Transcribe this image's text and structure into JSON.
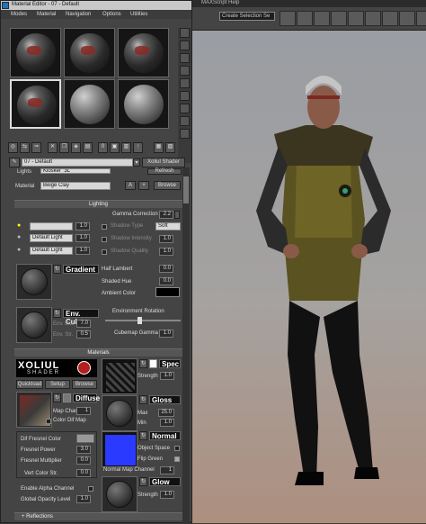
{
  "max": {
    "menu": [
      "MAXScript",
      "Help"
    ],
    "selection_set": "Create Selection Se"
  },
  "editor": {
    "title": "Material Editor - 07 - Default",
    "menu": [
      "Modes",
      "Material",
      "Navigation",
      "Options",
      "Utilities"
    ],
    "material_name": "07 - Default",
    "shader_button": "Xoliul Shader",
    "lights_label": "Lights",
    "lights_value": "Kiosker_3L",
    "refresh": "Refresh",
    "material_label": "Material",
    "material_value": "Beige Clay",
    "btn_a": "A",
    "btn_plus": "+",
    "browse": "Browse",
    "lighting": {
      "header": "Lighting",
      "gamma_label": "Gamma Correction",
      "gamma": "2.2",
      "light1_value": "1.0",
      "light2_value": "1.0",
      "light3_value": "1.0",
      "light_dd2": "Default Light",
      "light_dd3": "Default Light",
      "shadow_type_label": "Shadow Type",
      "shadow_type": "Soft",
      "shadow_intensity_label": "Shadow Intensity",
      "shadow_intensity": "1.0",
      "shadow_quality_label": "Shadow Quality",
      "shadow_quality": "1.0",
      "gradient": "Gradient",
      "half_lambert_label": "Half Lambert",
      "half_lambert": "0.0",
      "shaded_hue_label": "Shaded Hue",
      "shaded_hue": "0.0",
      "ambient_label": "Ambient Color",
      "env_cube": "Env. Cube",
      "env_blur_label": "Env. Blur",
      "env_blur": "7.0",
      "env_str_label": "Env. Str.",
      "env_str": "0.5",
      "env_rotation_label": "Environment Rotation",
      "cubemap_gamma_label": "Cubemap Gamma",
      "cubemap_gamma": "1.0"
    },
    "materials": {
      "header": "Materials",
      "logo_main": "XOLIUL",
      "logo_sub": "SHADER",
      "quickload": "Quickload",
      "setup": "Setup",
      "browse": "Browse",
      "spec": "Spec",
      "strength_label": "Strength",
      "spec_strength": "1.0",
      "diffuse": "Diffuse",
      "map_chan_label": "Map Chan",
      "map_chan": "1",
      "color_dif_map": "Color Dif Map",
      "gloss": "Gloss",
      "max_label": "Max",
      "gloss_max": "25.0",
      "min_label": "Min",
      "gloss_min": "1.0",
      "dif_fresnel_color": "Dif Fresnel Color",
      "fresnel_power_label": "Fresnel Power",
      "fresnel_power": "3.0",
      "fresnel_mult_label": "Fresnel Multiplier",
      "fresnel_mult": "0.0",
      "vert_color_label": "Vert Color Str.",
      "vert_color": "0.0",
      "normal": "Normal",
      "object_space": "Object Space",
      "flip_green": "Flip Green",
      "normal_chan_label": "Normal Map Channel",
      "normal_chan": "1",
      "glow": "Glow",
      "glow_strength": "1.0",
      "enable_alpha": "Enable Alpha Channel",
      "global_opacity_label": "Global Opacity Level",
      "global_opacity": "1.0"
    },
    "reflections": "Reflections"
  },
  "colors": {
    "accent_blue": "#2b3aff",
    "logo_red": "#b41e1e"
  }
}
